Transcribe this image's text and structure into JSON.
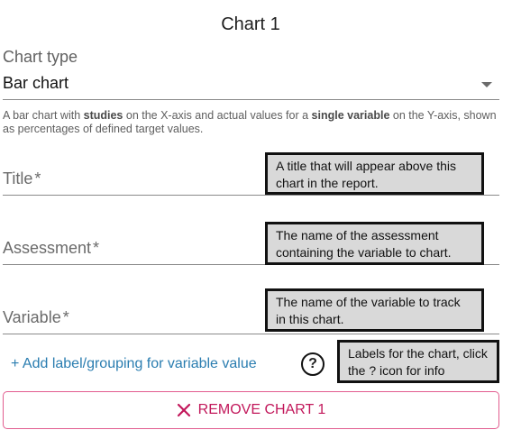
{
  "chart": {
    "heading": "Chart 1"
  },
  "chart_type": {
    "label": "Chart type",
    "value": "Bar chart",
    "helper_parts": [
      "A bar chart with ",
      "studies",
      " on the X-axis and actual values for a ",
      "single variable",
      " on the Y-axis, shown as percentages of defined target values."
    ]
  },
  "fields": {
    "title": {
      "label": "Title",
      "required_mark": "*",
      "tooltip": "A title that will appear above this chart in the report."
    },
    "assessment": {
      "label": "Assessment",
      "required_mark": "*",
      "tooltip": "The name of the assessment containing the variable to chart."
    },
    "variable": {
      "label": "Variable",
      "required_mark": "*",
      "tooltip": "The name of the variable to track in this chart."
    }
  },
  "grouping": {
    "add_label": "+ Add label/grouping for variable value",
    "help_icon_glyph": "?",
    "tooltip": "Labels for the chart, click the ? icon for info"
  },
  "remove_button": {
    "label": "REMOVE CHART 1",
    "icon": "close-icon",
    "color": "#c2185b"
  },
  "colors": {
    "link": "#2a7db0",
    "callout_bg": "#d9d9d9"
  }
}
